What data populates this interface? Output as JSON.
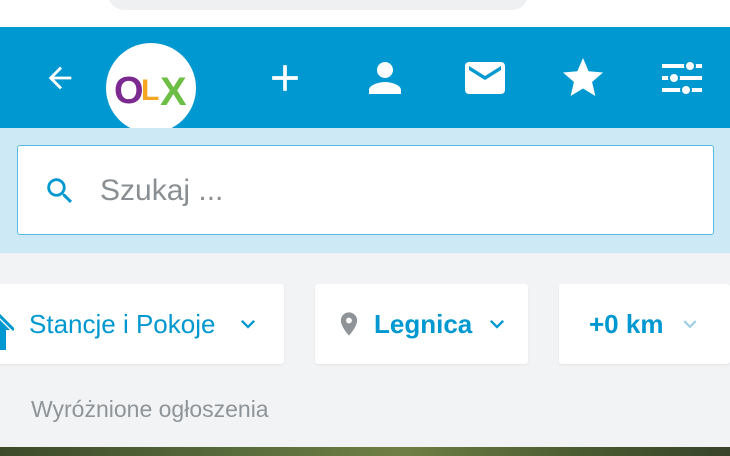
{
  "header": {
    "logo": {
      "letters": [
        "O",
        "L",
        "X"
      ],
      "colors": [
        "#7b2a8f",
        "#f5a623",
        "#6dbe45"
      ]
    },
    "icons": [
      "back-arrow-icon",
      "plus-icon",
      "person-icon",
      "mail-icon",
      "star-icon",
      "filter-sliders-icon"
    ]
  },
  "search": {
    "placeholder": "Szukaj ..."
  },
  "filters": {
    "category": {
      "label": "Stancje i Pokoje"
    },
    "location": {
      "label": "Legnica"
    },
    "distance": {
      "label": "+0 km"
    }
  },
  "section": {
    "title": "Wyróżnione ogłoszenia"
  },
  "colors": {
    "brand": "#0098d0",
    "search_area_bg": "#cde9f5",
    "page_bg": "#f2f3f4"
  }
}
